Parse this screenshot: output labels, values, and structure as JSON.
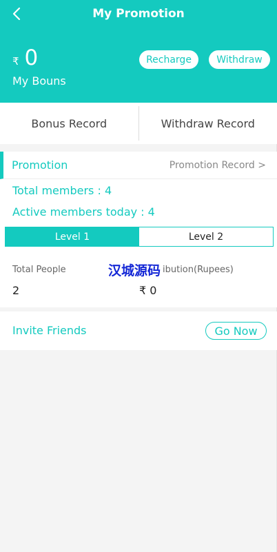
{
  "header": {
    "title": "My Promotion",
    "currency_symbol": "₹",
    "balance": "0",
    "balance_label": "My Bouns",
    "recharge_label": "Recharge",
    "withdraw_label": "Withdraw",
    "back_icon": "chevron-left-icon"
  },
  "records": {
    "bonus_record": "Bonus Record",
    "withdraw_record": "Withdraw Record"
  },
  "promotion": {
    "title": "Promotion",
    "record_link": "Promotion Record >",
    "total_members": "Total members :  4",
    "active_members": "Active members today :  4",
    "levels": [
      {
        "label": "Level 1",
        "selected": true
      },
      {
        "label": "Level 2",
        "selected": false
      }
    ],
    "columns": {
      "people_label": "Total People",
      "contribution_label": "ibution(Rupees)",
      "people_value": "2",
      "contribution_value": "₹ 0"
    },
    "watermark": "汉城源码"
  },
  "invite": {
    "label": "Invite Friends",
    "button": "Go Now"
  },
  "colors": {
    "accent": "#14cabf",
    "background": "#f4f4f4",
    "watermark": "#1427d6"
  }
}
